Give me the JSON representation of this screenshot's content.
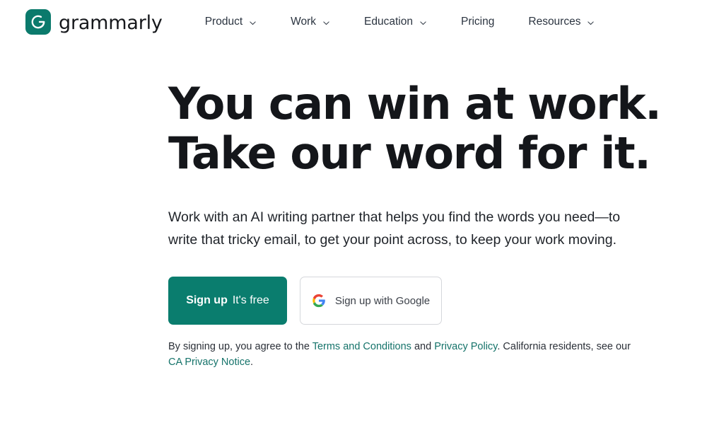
{
  "brand": {
    "name": "grammarly",
    "logo_icon": "grammarly-g-logo-icon",
    "logo_color": "#0b7a6c"
  },
  "nav": {
    "items": [
      {
        "label": "Product",
        "has_dropdown": true,
        "icon": "chevron-down-icon"
      },
      {
        "label": "Work",
        "has_dropdown": true,
        "icon": "chevron-down-icon"
      },
      {
        "label": "Education",
        "has_dropdown": true,
        "icon": "chevron-down-icon"
      },
      {
        "label": "Pricing",
        "has_dropdown": false,
        "icon": ""
      },
      {
        "label": "Resources",
        "has_dropdown": true,
        "icon": "chevron-down-icon"
      }
    ]
  },
  "hero": {
    "title_line1": "You can win at work.",
    "title_line2": "Take our word for it.",
    "subtitle": "Work with an AI writing partner that helps you find the words you need—to write that tricky email, to get your point across, to keep your work moving."
  },
  "cta": {
    "primary": {
      "strong_label": "Sign up",
      "light_label": "It's free",
      "background": "#0a7d6e",
      "text_color": "#ffffff"
    },
    "google": {
      "label": "Sign up with Google",
      "icon": "google-g-icon",
      "border_color": "#d5d7db"
    }
  },
  "legal": {
    "text_1": "By signing up, you agree to the ",
    "link_terms": "Terms and Conditions",
    "text_2": " and ",
    "link_privacy": "Privacy Policy",
    "text_3": ". California residents, see our ",
    "link_ca": "CA Privacy Notice",
    "text_4": ".",
    "link_color": "#15736a"
  }
}
